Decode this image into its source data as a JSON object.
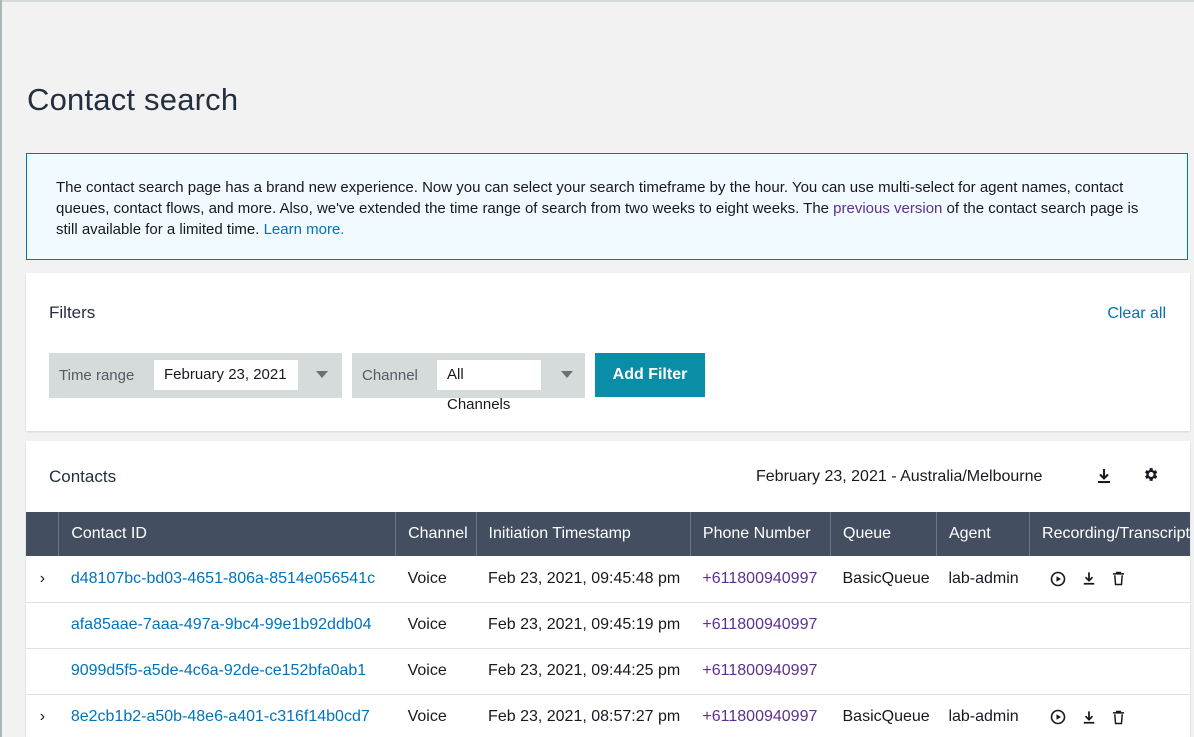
{
  "page": {
    "title": "Contact search"
  },
  "info": {
    "text_before": "The contact search page has a brand new experience. Now you can select your search timeframe by the hour. You can use multi-select for agent names, contact queues, contact flows, and more. Also, we've extended the time range of search from two weeks to eight weeks. The ",
    "previous_version_link": "previous version",
    "text_middle": " of the contact search page is still available for a limited time. ",
    "learn_more_link": "Learn more."
  },
  "filters": {
    "title": "Filters",
    "clear_all": "Clear all",
    "time_range": {
      "label": "Time range",
      "value": "February 23, 2021"
    },
    "channel": {
      "label": "Channel",
      "value": "All Channels"
    },
    "add_filter": "Add Filter"
  },
  "contacts": {
    "title": "Contacts",
    "range": "February 23, 2021 - Australia/Melbourne",
    "columns": [
      "Contact ID",
      "Channel",
      "Initiation Timestamp",
      "Phone Number",
      "Queue",
      "Agent",
      "Recording/Transcript"
    ],
    "rows": [
      {
        "expandable": true,
        "contact_id": "d48107bc-bd03-4651-806a-8514e056541c",
        "channel": "Voice",
        "timestamp": "Feb 23, 2021, 09:45:48 pm",
        "phone": "+611800940997",
        "queue": "BasicQueue",
        "agent": "lab-admin",
        "has_recording": true
      },
      {
        "expandable": false,
        "contact_id": "afa85aae-7aaa-497a-9bc4-99e1b92ddb04",
        "channel": "Voice",
        "timestamp": "Feb 23, 2021, 09:45:19 pm",
        "phone": "+611800940997",
        "queue": "",
        "agent": "",
        "has_recording": false
      },
      {
        "expandable": false,
        "contact_id": "9099d5f5-a5de-4c6a-92de-ce152bfa0ab1",
        "channel": "Voice",
        "timestamp": "Feb 23, 2021, 09:44:25 pm",
        "phone": "+611800940997",
        "queue": "",
        "agent": "",
        "has_recording": false
      },
      {
        "expandable": true,
        "contact_id": "8e2cb1b2-a50b-48e6-a401-c316f14b0cd7",
        "channel": "Voice",
        "timestamp": "Feb 23, 2021, 08:57:27 pm",
        "phone": "+611800940997",
        "queue": "BasicQueue",
        "agent": "lab-admin",
        "has_recording": true
      }
    ]
  },
  "icons": {
    "expand": "chevron-right-icon",
    "download": "download-icon",
    "settings": "gear-icon",
    "play": "play-icon",
    "delete": "trash-icon",
    "caret": "caret-down-icon"
  },
  "colors": {
    "link": "#0073bb",
    "visited_link": "#5d2f8e",
    "primary_button": "#0a8ea8",
    "table_header": "#434f60",
    "info_border": "#0073bb",
    "info_bg": "#f1faff"
  }
}
